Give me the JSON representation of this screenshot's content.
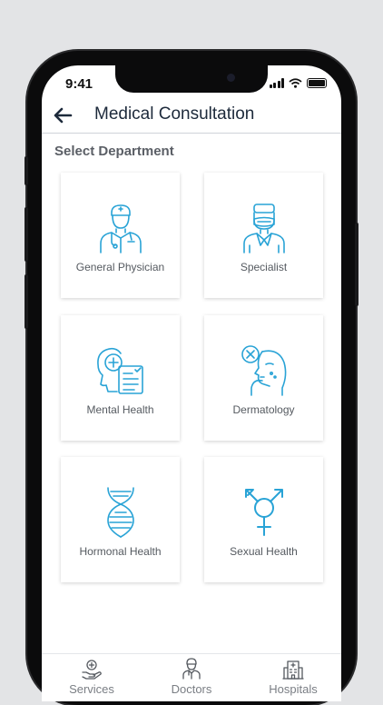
{
  "status_bar": {
    "time": "9:41"
  },
  "header": {
    "title": "Medical Consultation",
    "back_icon": "arrow-left-icon"
  },
  "section_title": "Select Department",
  "accent_color": "#29a3d6",
  "departments": [
    {
      "label": "General Physician",
      "icon": "doctor-icon"
    },
    {
      "label": "Specialist",
      "icon": "surgeon-icon"
    },
    {
      "label": "Mental Health",
      "icon": "mind-report-icon"
    },
    {
      "label": "Dermatology",
      "icon": "face-skin-icon"
    },
    {
      "label": "Hormonal Health",
      "icon": "dna-icon"
    },
    {
      "label": "Sexual Health",
      "icon": "gender-symbol-icon"
    }
  ],
  "bottom_nav": [
    {
      "label": "Services",
      "icon": "services-icon"
    },
    {
      "label": "Doctors",
      "icon": "doctor-icon"
    },
    {
      "label": "Hospitals",
      "icon": "hospital-icon"
    }
  ]
}
